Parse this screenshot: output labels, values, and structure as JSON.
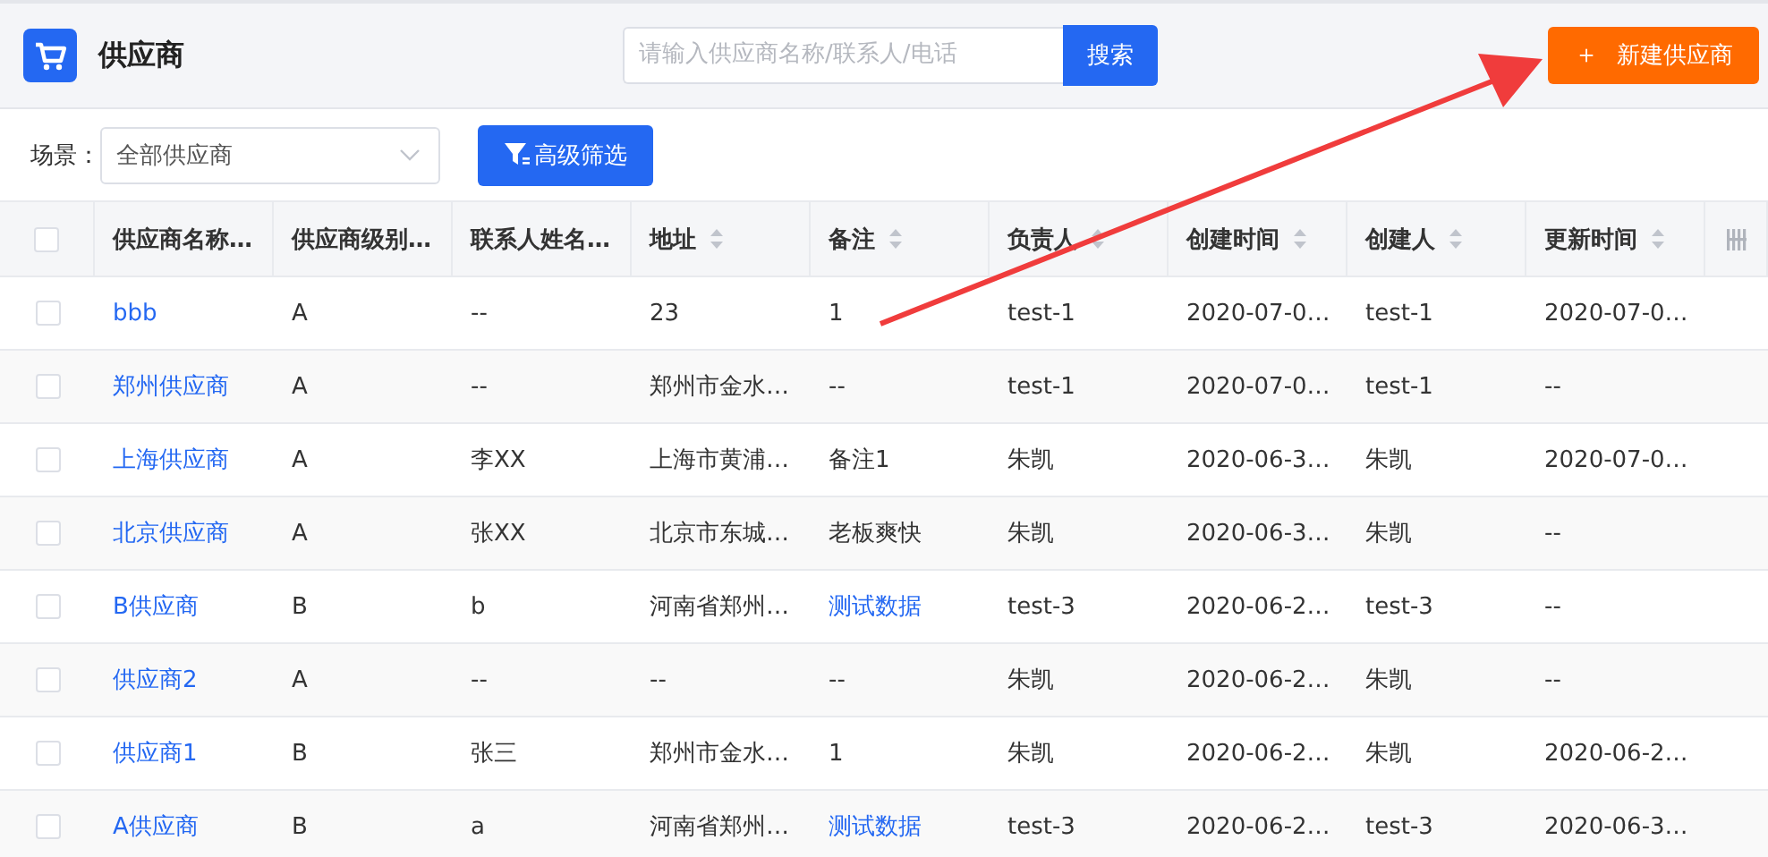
{
  "header": {
    "title": "供应商",
    "search": {
      "placeholder": "请输入供应商名称/联系人/电话",
      "button": "搜索"
    },
    "create_button": {
      "icon": "＋",
      "label": "新建供应商"
    }
  },
  "filter": {
    "scene_label": "场景：",
    "scene_value": "全部供应商",
    "advanced_button": "高级筛选"
  },
  "table": {
    "select_all_checked": false,
    "columns": [
      {
        "label": "供应商名称…",
        "sortable": false
      },
      {
        "label": "供应商级别…",
        "sortable": false
      },
      {
        "label": "联系人姓名…",
        "sortable": false
      },
      {
        "label": "地址",
        "sortable": true
      },
      {
        "label": "备注",
        "sortable": true
      },
      {
        "label": "负责人",
        "sortable": true
      },
      {
        "label": "创建时间",
        "sortable": true
      },
      {
        "label": "创建人",
        "sortable": true
      },
      {
        "label": "更新时间",
        "sortable": true
      }
    ],
    "rows": [
      {
        "checked": false,
        "remark_link": false,
        "cells": [
          "bbb",
          "A",
          "--",
          "23",
          "1",
          "test-1",
          "2020-07-0…",
          "test-1",
          "2020-07-0…"
        ]
      },
      {
        "checked": false,
        "remark_link": false,
        "cells": [
          "郑州供应商",
          "A",
          "--",
          "郑州市金水…",
          "--",
          "test-1",
          "2020-07-0…",
          "test-1",
          "--"
        ]
      },
      {
        "checked": false,
        "remark_link": false,
        "cells": [
          "上海供应商",
          "A",
          "李XX",
          "上海市黄浦…",
          "备注1",
          "朱凯",
          "2020-06-3…",
          "朱凯",
          "2020-07-0…"
        ]
      },
      {
        "checked": false,
        "remark_link": false,
        "cells": [
          "北京供应商",
          "A",
          "张XX",
          "北京市东城…",
          "老板爽快",
          "朱凯",
          "2020-06-3…",
          "朱凯",
          "--"
        ]
      },
      {
        "checked": false,
        "remark_link": true,
        "cells": [
          "B供应商",
          "B",
          "b",
          "河南省郑州…",
          "测试数据",
          "test-3",
          "2020-06-2…",
          "test-3",
          "--"
        ]
      },
      {
        "checked": false,
        "remark_link": false,
        "cells": [
          "供应商2",
          "A",
          "--",
          "--",
          "--",
          "朱凯",
          "2020-06-2…",
          "朱凯",
          "--"
        ]
      },
      {
        "checked": false,
        "remark_link": false,
        "cells": [
          "供应商1",
          "B",
          "张三",
          "郑州市金水…",
          "1",
          "朱凯",
          "2020-06-2…",
          "朱凯",
          "2020-06-2…"
        ]
      },
      {
        "checked": false,
        "remark_link": true,
        "cells": [
          "A供应商",
          "B",
          "a",
          "河南省郑州…",
          "测试数据",
          "test-3",
          "2020-06-2…",
          "test-3",
          "2020-06-3…"
        ]
      }
    ]
  }
}
